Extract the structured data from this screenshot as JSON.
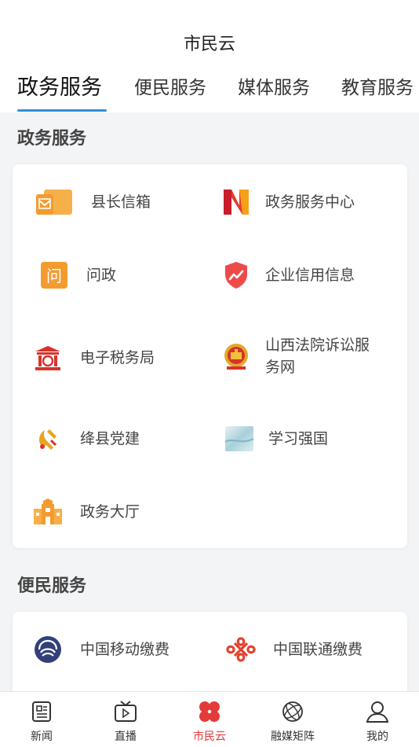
{
  "header": {
    "title": "市民云"
  },
  "tabs": [
    {
      "label": "政务服务",
      "active": true
    },
    {
      "label": "便民服务",
      "active": false
    },
    {
      "label": "媒体服务",
      "active": false
    },
    {
      "label": "教育服务",
      "active": false
    }
  ],
  "gov": {
    "title": "政务服务",
    "items": [
      {
        "label": "县长信箱",
        "icon": "mailbox-icon"
      },
      {
        "label": "政务服务中心",
        "icon": "gov-center-logo-icon"
      },
      {
        "label": "问政",
        "icon": "ask-gov-icon"
      },
      {
        "label": "企业信用信息",
        "icon": "credit-shield-icon"
      },
      {
        "label": "电子税务局",
        "icon": "tax-bureau-icon"
      },
      {
        "label": "山西法院诉讼服务网",
        "icon": "court-emblem-icon"
      },
      {
        "label": "绛县党建",
        "icon": "party-emblem-icon"
      },
      {
        "label": "学习强国",
        "icon": "xuexi-qiangguo-icon"
      },
      {
        "label": "政务大厅",
        "icon": "gov-hall-icon"
      }
    ]
  },
  "convenience": {
    "title": "便民服务",
    "items": [
      {
        "label": "中国移动缴费",
        "icon": "china-mobile-icon"
      },
      {
        "label": "中国联通缴费",
        "icon": "china-unicom-icon"
      }
    ]
  },
  "nav": [
    {
      "label": "新闻",
      "icon": "news-icon"
    },
    {
      "label": "直播",
      "icon": "tv-live-icon"
    },
    {
      "label": "市民云",
      "icon": "clover-icon",
      "active": true
    },
    {
      "label": "融媒矩阵",
      "icon": "sphere-icon"
    },
    {
      "label": "我的",
      "icon": "user-icon"
    }
  ],
  "colors": {
    "accent_blue": "#2f8fd8",
    "active_red": "#e33a3a",
    "orange": "#f3a23a"
  }
}
